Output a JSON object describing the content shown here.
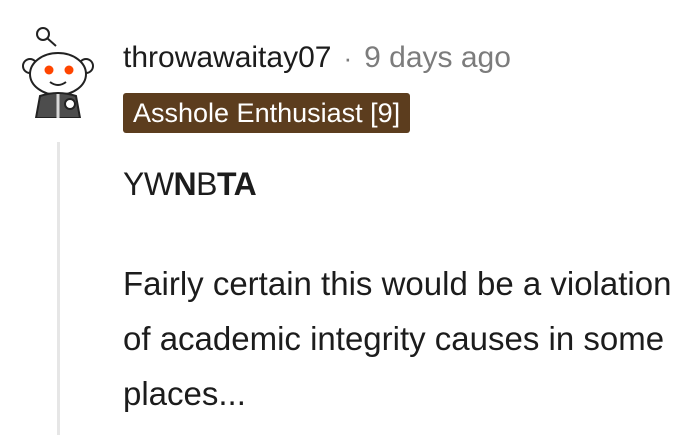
{
  "comment": {
    "author": "throwawaitay07",
    "separator": "·",
    "timestamp": "9 days ago",
    "flair": "Asshole Enthusiast [9]",
    "verdict": {
      "p1": "YW",
      "p2": "N",
      "p3": "B",
      "p4": "TA"
    },
    "body": "Fairly certain this would be a violation of academic integrity causes in some places...",
    "avatar_icon": "snoo-avatar-icon"
  },
  "colors": {
    "flair_background": "#5c3d1e",
    "flair_text": "#ffffff",
    "username": "#1c1c1c",
    "meta_gray": "#7c7c7c",
    "thread_line": "#e6e6e6"
  }
}
